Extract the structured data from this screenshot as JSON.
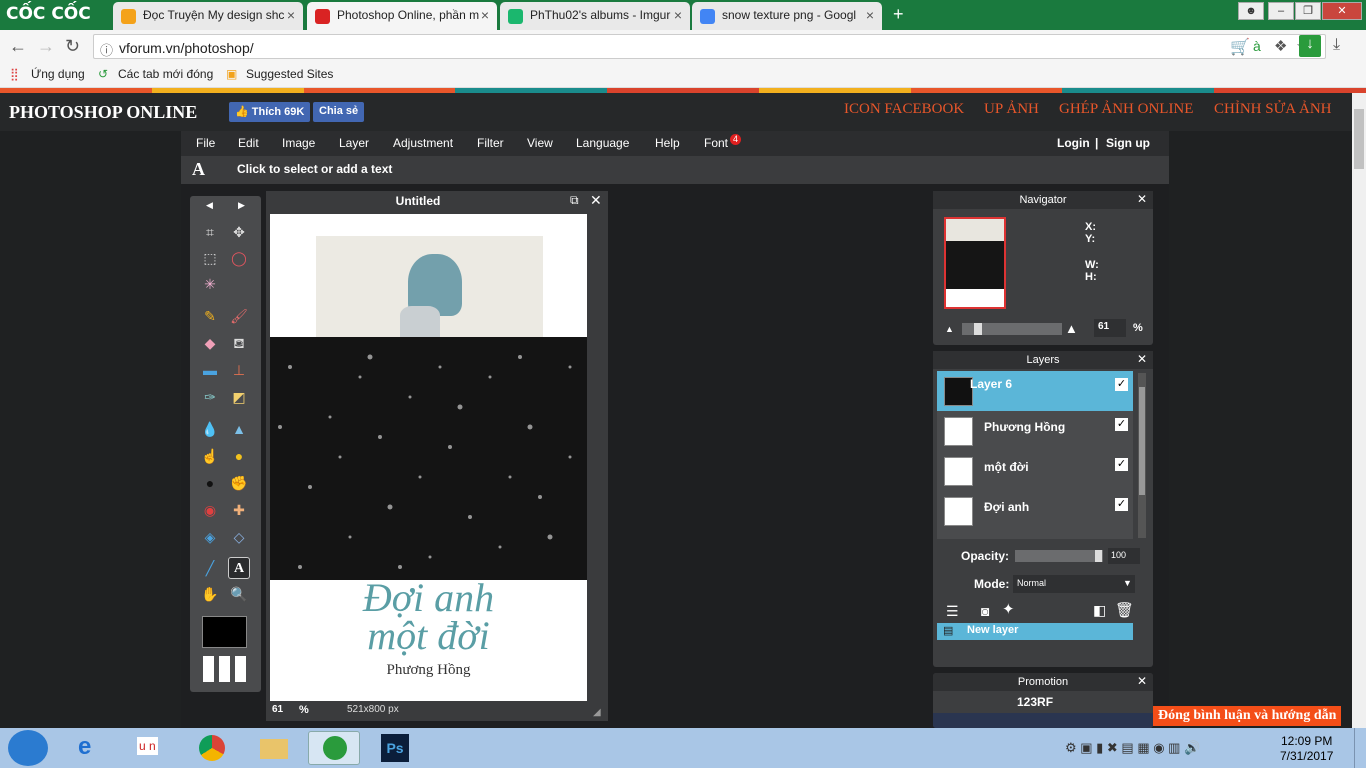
{
  "browser": {
    "brand": "CỐC CỐC",
    "tabs": [
      {
        "label": "Đọc Truyện My design shc",
        "icon_color": "#f4a21a"
      },
      {
        "label": "Photoshop Online, phần m",
        "icon_color": "#d92323"
      },
      {
        "label": "PhThu02's albums - Imgur",
        "icon_color": "#1bb76e"
      },
      {
        "label": "snow texture png - Googl",
        "icon_color": "#4285f4"
      }
    ],
    "url": "vforum.vn/photoshop/",
    "bookmarks": [
      "Ứng dụng",
      "Các tab mới đóng",
      "Suggested Sites"
    ]
  },
  "site": {
    "title": "PHOTOSHOP ONLINE",
    "fb_like": "Thích 69K",
    "fb_share": "Chia sẻ",
    "header_links": [
      "ICON FACEBOOK",
      "UP ẢNH",
      "GHÉP ẢNH ONLINE",
      "CHỈNH SỬA ẢNH"
    ],
    "stripe_colors": [
      "#e8562a",
      "#f2b01e",
      "#e8562a",
      "#1a8c8c",
      "#d9432c",
      "#f2b01e",
      "#e8562a",
      "#1a8c8c",
      "#d9432c"
    ]
  },
  "editor": {
    "menu": [
      "File",
      "Edit",
      "Image",
      "Layer",
      "Adjustment",
      "Filter",
      "View",
      "Language",
      "Help",
      "Font"
    ],
    "font_badge": "4",
    "login": "Login",
    "signup": "Sign up",
    "option_hint": "Click to select or add a text",
    "document": {
      "title": "Untitled",
      "zoom": "61",
      "zoom_unit": "%",
      "size": "521x800 px",
      "poster_title": "Đợi anh",
      "poster_title2": "một đời",
      "poster_author": "Phương Hồng"
    },
    "navigator": {
      "title": "Navigator",
      "x_label": "X:",
      "y_label": "Y:",
      "w_label": "W:",
      "h_label": "H:",
      "zoom_value": "61",
      "zoom_unit": "%"
    },
    "layers": {
      "title": "Layers",
      "items": [
        {
          "name": "Layer 6",
          "checked": "✓"
        },
        {
          "name": "Phương Hồng",
          "checked": "✓"
        },
        {
          "name": "một đời",
          "checked": "✓"
        },
        {
          "name": "Đợi anh",
          "checked": "✓"
        }
      ],
      "opacity_label": "Opacity:",
      "opacity_value": "100",
      "mode_label": "Mode:",
      "mode_value": "Normal",
      "new_layer": "New layer"
    },
    "promotion": {
      "title": "Promotion",
      "brand": "123RF",
      "banner_text": "Đóng bình luận và hướng dẫn"
    }
  },
  "taskbar": {
    "time": "12:09 PM",
    "date": "7/31/2017"
  }
}
